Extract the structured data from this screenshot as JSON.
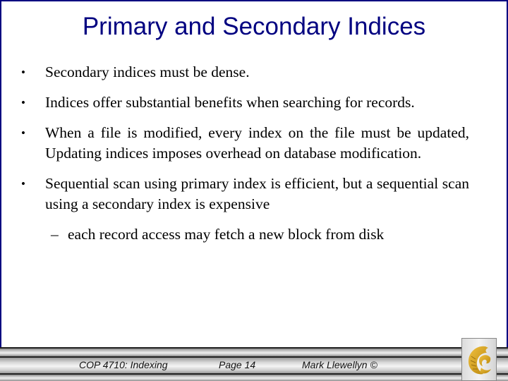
{
  "slide": {
    "title": "Primary and Secondary Indices",
    "bullets": [
      {
        "marker": "•",
        "text": "Secondary indices must be dense."
      },
      {
        "marker": "•",
        "text": "Indices offer substantial benefits when searching for records."
      },
      {
        "marker": "•",
        "text": "When a file is modified, every index on the file must be updated, Updating indices imposes overhead on database modification."
      },
      {
        "marker": "•",
        "text": "Sequential scan using primary index is efficient, but a sequential scan using a secondary index is expensive",
        "subitems": [
          {
            "marker": "–",
            "text": "each record access may fetch a new block from disk"
          }
        ]
      }
    ]
  },
  "footer": {
    "course": "COP 4710: Indexing",
    "page": "Page 14",
    "author": "Mark Llewellyn ©",
    "logo_icon": "pegasus-logo-icon"
  },
  "colors": {
    "title": "#000080",
    "border": "#000080",
    "logo_gold": "#C9A227"
  }
}
